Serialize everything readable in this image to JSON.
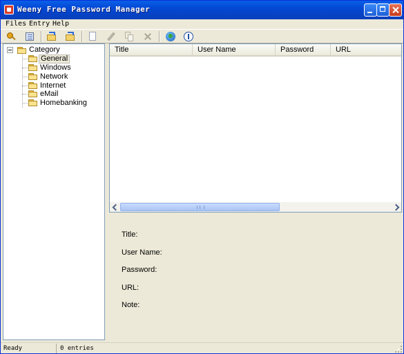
{
  "window": {
    "title": "Weeny Free Password Manager"
  },
  "menu": {
    "files": "Files",
    "entry": "Entry",
    "help": "Help"
  },
  "toolbar": {
    "icons": [
      "key-icon",
      "list-icon",
      "import-icon",
      "export-icon",
      "new-entry-icon",
      "edit-icon",
      "copy-icon",
      "delete-icon",
      "web-icon",
      "info-icon"
    ]
  },
  "tree": {
    "root": "Category",
    "items": [
      "General",
      "Windows",
      "Network",
      "Internet",
      "eMail",
      "Homebanking"
    ],
    "selected": "General"
  },
  "list": {
    "columns": [
      "Title",
      "User Name",
      "Password",
      "URL"
    ]
  },
  "details": {
    "title_label": "Title:",
    "user_label": "User Name:",
    "password_label": "Password:",
    "url_label": "URL:",
    "note_label": "Note:"
  },
  "status": {
    "state": "Ready",
    "entries": "0 entries"
  },
  "colors": {
    "titlebar": "#0348d4",
    "face": "#ece9d8",
    "border": "#7f9db9"
  }
}
